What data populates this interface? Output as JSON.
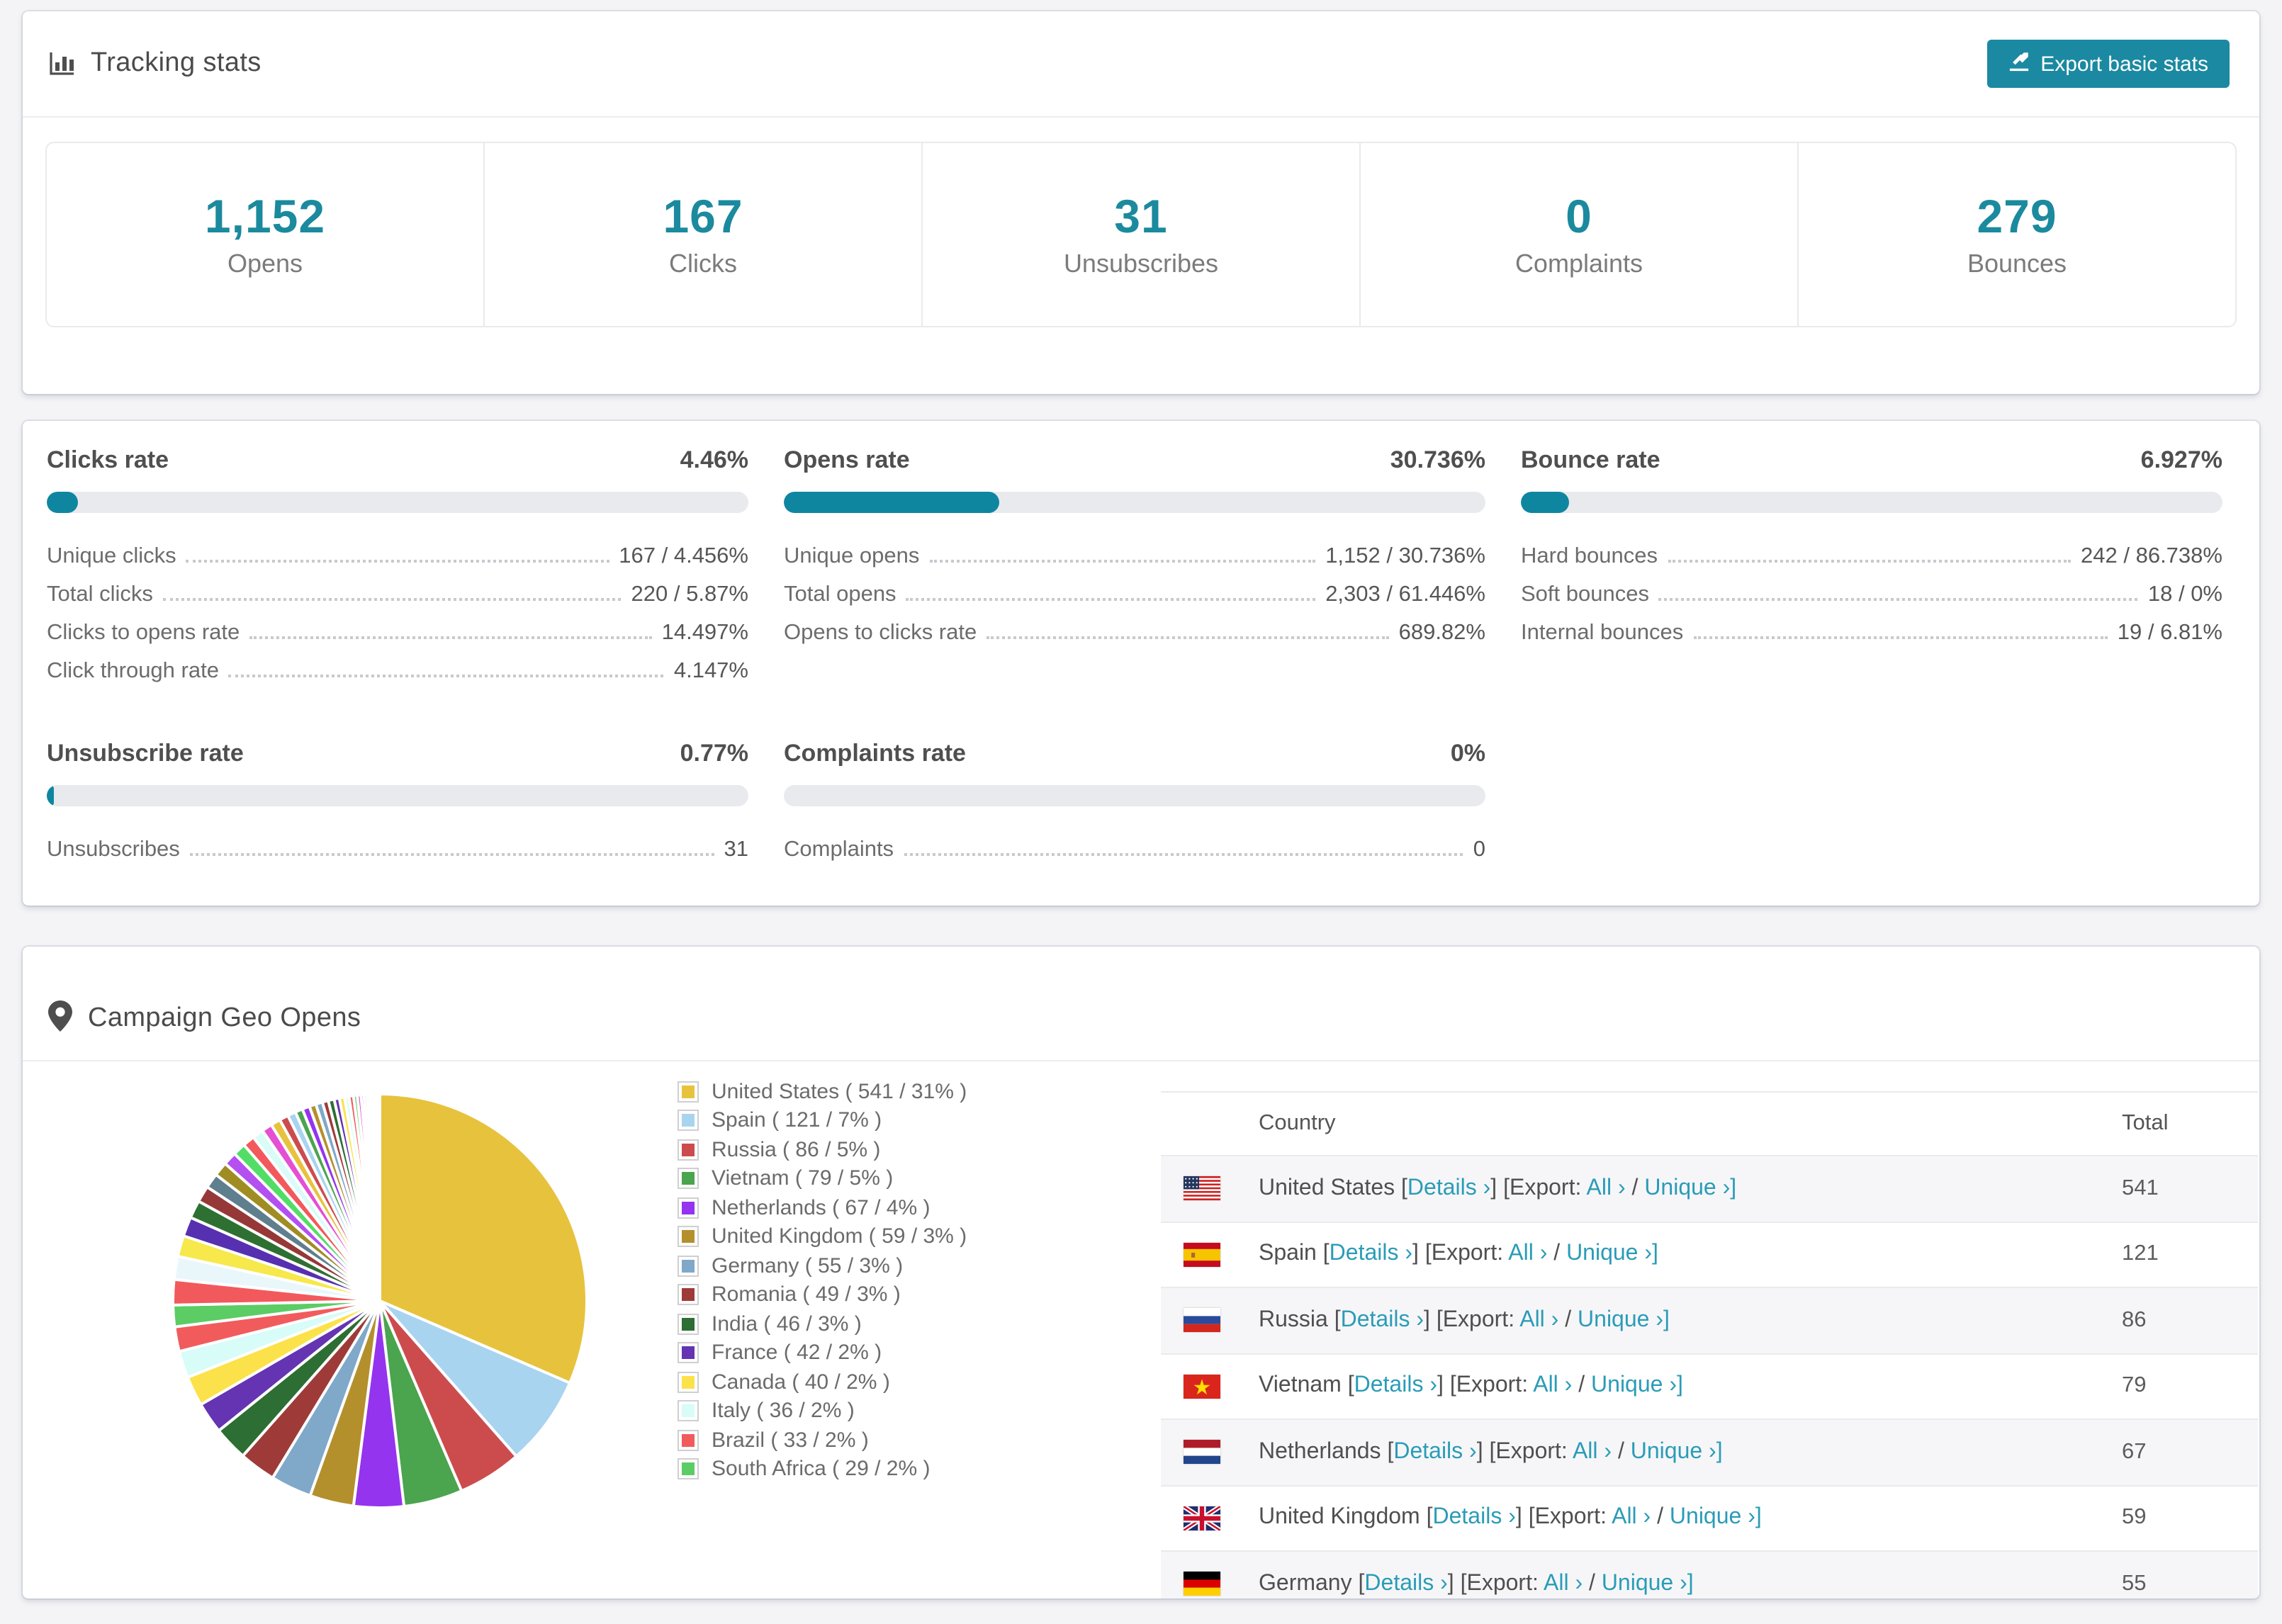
{
  "header": {
    "title": "Tracking stats",
    "export_label": "Export basic stats"
  },
  "summary": [
    {
      "value": "1,152",
      "label": "Opens"
    },
    {
      "value": "167",
      "label": "Clicks"
    },
    {
      "value": "31",
      "label": "Unsubscribes"
    },
    {
      "value": "0",
      "label": "Complaints"
    },
    {
      "value": "279",
      "label": "Bounces"
    }
  ],
  "rates": [
    {
      "title": "Clicks rate",
      "value": "4.46%",
      "percent": 4.46,
      "rows": [
        {
          "label": "Unique clicks",
          "value": "167 / 4.456%"
        },
        {
          "label": "Total clicks",
          "value": "220 / 5.87%"
        },
        {
          "label": "Clicks to opens rate",
          "value": "14.497%"
        },
        {
          "label": "Click through rate",
          "value": "4.147%"
        }
      ]
    },
    {
      "title": "Opens rate",
      "value": "30.736%",
      "percent": 30.736,
      "rows": [
        {
          "label": "Unique opens",
          "value": "1,152 / 30.736%"
        },
        {
          "label": "Total opens",
          "value": "2,303 / 61.446%"
        },
        {
          "label": "Opens to clicks rate",
          "value": "689.82%"
        }
      ]
    },
    {
      "title": "Bounce rate",
      "value": "6.927%",
      "percent": 6.927,
      "rows": [
        {
          "label": "Hard bounces",
          "value": "242 / 86.738%"
        },
        {
          "label": "Soft bounces",
          "value": "18 / 0%"
        },
        {
          "label": "Internal bounces",
          "value": "19 / 6.81%"
        }
      ]
    },
    {
      "title": "Unsubscribe rate",
      "value": "0.77%",
      "percent": 0.77,
      "rows": [
        {
          "label": "Unsubscribes",
          "value": "31"
        }
      ]
    },
    {
      "title": "Complaints rate",
      "value": "0%",
      "percent": 0,
      "rows": [
        {
          "label": "Complaints",
          "value": "0"
        }
      ]
    }
  ],
  "geo": {
    "title": "Campaign Geo Opens",
    "table_headers": {
      "country": "Country",
      "total": "Total"
    },
    "link_labels": {
      "details": "Details ›",
      "export": "[Export:",
      "all": "All ›",
      "slash": "/",
      "unique": "Unique ›]",
      "open_bracket": "[",
      "close_bracket": "]"
    },
    "rows": [
      {
        "country": "United States",
        "flag": "us",
        "total": "541"
      },
      {
        "country": "Spain",
        "flag": "es",
        "total": "121"
      },
      {
        "country": "Russia",
        "flag": "ru",
        "total": "86"
      },
      {
        "country": "Vietnam",
        "flag": "vn",
        "total": "79"
      },
      {
        "country": "Netherlands",
        "flag": "nl",
        "total": "67"
      },
      {
        "country": "United Kingdom",
        "flag": "gb",
        "total": "59"
      },
      {
        "country": "Germany",
        "flag": "de",
        "total": "55"
      }
    ]
  },
  "chart_data": {
    "type": "pie",
    "title": "Campaign Geo Opens",
    "legend_position": "right",
    "start_angle_deg": -90,
    "direction": "clockwise",
    "slices": [
      {
        "label": "United States ( 541 / 31% )",
        "name": "United States",
        "value": 541,
        "color": "#e7c23d"
      },
      {
        "label": "Spain ( 121 / 7% )",
        "name": "Spain",
        "value": 121,
        "color": "#a8d4f0"
      },
      {
        "label": "Russia ( 86 / 5% )",
        "name": "Russia",
        "value": 86,
        "color": "#cc4c4e"
      },
      {
        "label": "Vietnam ( 79 / 5% )",
        "name": "Vietnam",
        "value": 79,
        "color": "#4ba44e"
      },
      {
        "label": "Netherlands ( 67 / 4% )",
        "name": "Netherlands",
        "value": 67,
        "color": "#9434ee"
      },
      {
        "label": "United Kingdom ( 59 / 3% )",
        "name": "United Kingdom",
        "value": 59,
        "color": "#b3902c"
      },
      {
        "label": "Germany ( 55 / 3% )",
        "name": "Germany",
        "value": 55,
        "color": "#7fa8c9"
      },
      {
        "label": "Romania ( 49 / 3% )",
        "name": "Romania",
        "value": 49,
        "color": "#9e3b38"
      },
      {
        "label": "India ( 46 / 3% )",
        "name": "India",
        "value": 46,
        "color": "#2c6e33"
      },
      {
        "label": "France ( 42 / 2% )",
        "name": "France",
        "value": 42,
        "color": "#6434b2"
      },
      {
        "label": "Canada ( 40 / 2% )",
        "name": "Canada",
        "value": 40,
        "color": "#fbe24a"
      },
      {
        "label": "Italy ( 36 / 2% )",
        "name": "Italy",
        "value": 36,
        "color": "#d8fcf8"
      },
      {
        "label": "Brazil ( 33 / 2% )",
        "name": "Brazil",
        "value": 33,
        "color": "#f25b5c"
      },
      {
        "label": "South Africa ( 29 / 2% )",
        "name": "South Africa",
        "value": 29,
        "color": "#5ccc65"
      }
    ],
    "unlabeled_small_slices": [
      [
        34,
        "#f2595c"
      ],
      [
        31,
        "#e9f7fb"
      ],
      [
        28,
        "#f7e84b"
      ],
      [
        26,
        "#5630b0"
      ],
      [
        24,
        "#2e7031"
      ],
      [
        22,
        "#963838"
      ],
      [
        20,
        "#5f7e8e"
      ],
      [
        19,
        "#9f8d24"
      ],
      [
        18,
        "#b44ff0"
      ],
      [
        17,
        "#52de66"
      ],
      [
        16,
        "#f2595c"
      ],
      [
        15,
        "#d9fcf7"
      ],
      [
        14,
        "#e44fd4"
      ],
      [
        13,
        "#e7c23d"
      ],
      [
        12,
        "#cc4c4e"
      ],
      [
        11,
        "#a8d4f0"
      ],
      [
        10,
        "#4ba44e"
      ],
      [
        10,
        "#9434ee"
      ],
      [
        9,
        "#b3902c"
      ],
      [
        9,
        "#7fa8c9"
      ],
      [
        8,
        "#9e3b38"
      ],
      [
        8,
        "#2c6e33"
      ],
      [
        7,
        "#6434b2"
      ],
      [
        7,
        "#fbe24a"
      ],
      [
        6,
        "#d8fcf8"
      ],
      [
        6,
        "#f25b5c"
      ],
      [
        5,
        "#5ccc65"
      ],
      [
        5,
        "#e44fd4"
      ],
      [
        4,
        "#3a49c4"
      ],
      [
        4,
        "#e8a03c"
      ],
      [
        3,
        "#cc4c4e"
      ],
      [
        3,
        "#4ba44e"
      ],
      [
        2,
        "#9434ee"
      ],
      [
        2,
        "#e7c23d"
      ],
      [
        2,
        "#a8d4f0"
      ],
      [
        1,
        "#f2595c"
      ],
      [
        1,
        "#52de66"
      ],
      [
        1,
        "#b44ff0"
      ],
      [
        1,
        "#2e7031"
      ],
      [
        1,
        "#963838"
      ]
    ]
  }
}
